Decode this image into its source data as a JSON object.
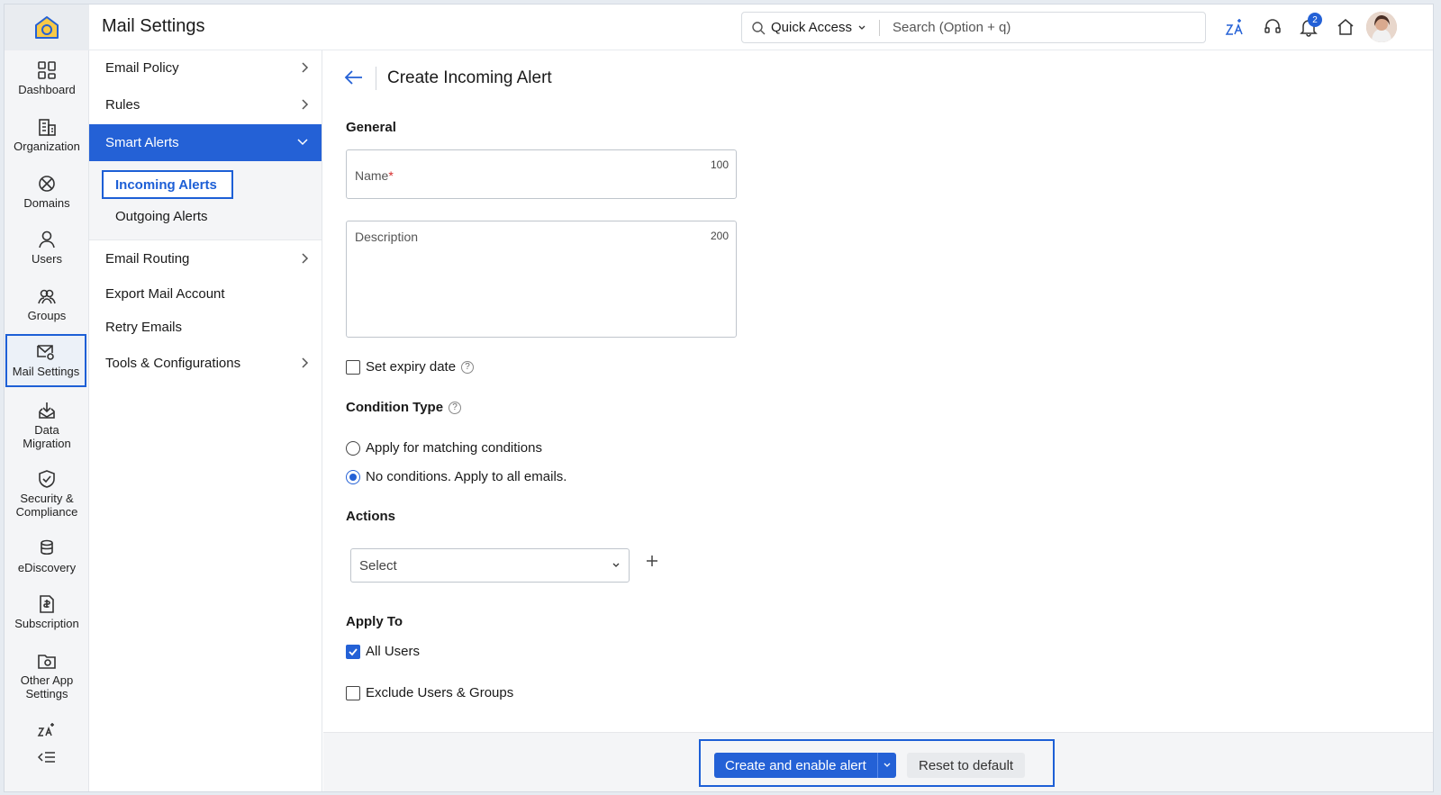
{
  "app": {
    "title": "Mail Settings"
  },
  "header": {
    "quick_access": "Quick Access",
    "search_placeholder": "Search (Option + q)",
    "notification_count": "2"
  },
  "rail": {
    "items": [
      {
        "label": "Dashboard",
        "icon": "dashboard-icon"
      },
      {
        "label": "Organization",
        "icon": "organization-icon"
      },
      {
        "label": "Domains",
        "icon": "domains-icon"
      },
      {
        "label": "Users",
        "icon": "user-icon"
      },
      {
        "label": "Groups",
        "icon": "groups-icon"
      },
      {
        "label": "Mail Settings",
        "icon": "mail-settings-icon",
        "active": true
      },
      {
        "label": "Data Migration",
        "icon": "data-migration-icon"
      },
      {
        "label": "Security & Compliance",
        "icon": "shield-icon"
      },
      {
        "label": "eDiscovery",
        "icon": "ediscovery-icon"
      },
      {
        "label": "Subscription",
        "icon": "subscription-icon"
      },
      {
        "label": "Other App Settings",
        "icon": "app-settings-icon"
      }
    ]
  },
  "submenu": {
    "items": [
      {
        "label": "Email Policy"
      },
      {
        "label": "Rules"
      },
      {
        "label": "Smart Alerts",
        "active": true
      },
      {
        "label": "Email Routing"
      },
      {
        "label": "Export Mail Account"
      },
      {
        "label": "Retry Emails"
      },
      {
        "label": "Tools & Configurations"
      }
    ],
    "smart_alerts_children": [
      {
        "label": "Incoming Alerts",
        "active": true
      },
      {
        "label": "Outgoing Alerts"
      }
    ]
  },
  "form": {
    "page_title": "Create Incoming Alert",
    "general_heading": "General",
    "name_label": "Name",
    "name_required_mark": "*",
    "name_max": "100",
    "description_label": "Description",
    "description_max": "200",
    "expiry_label": "Set expiry date",
    "condition_heading": "Condition Type",
    "condition_options": [
      {
        "label": "Apply for matching conditions",
        "selected": false
      },
      {
        "label": "No conditions. Apply to all emails.",
        "selected": true
      }
    ],
    "actions_heading": "Actions",
    "actions_select": "Select",
    "apply_to_heading": "Apply To",
    "all_users_label": "All Users",
    "all_users_checked": true,
    "exclude_label": "Exclude Users & Groups",
    "exclude_checked": false
  },
  "footer": {
    "primary_label": "Create and enable alert",
    "secondary_label": "Reset to default"
  },
  "colors": {
    "accent": "#2461d6",
    "highlight_border": "#1d5fd6"
  }
}
